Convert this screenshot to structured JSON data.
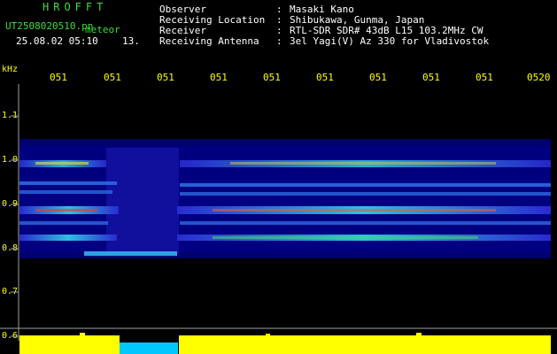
{
  "header": {
    "app_title": "HROFFT",
    "file_name": "UT2508020510.pn",
    "file_tag": "meteor",
    "time_stamp": "25.08.02 05:10",
    "count": "13.",
    "info": [
      {
        "label": "Observer",
        "value": "Masaki Kano"
      },
      {
        "label": "Receiving Location",
        "value": "Shibukawa, Gunma, Japan"
      },
      {
        "label": "Receiver",
        "value": "RTL-SDR SDR# 43dB L15 103.2MHz CW"
      },
      {
        "label": "Receiving Antenna",
        "value": "3el Yagi(V) Az 330 for Vladivostok"
      }
    ]
  },
  "axis": {
    "unit": "kHz",
    "time_ticks": [
      "051",
      "051",
      "051",
      "051",
      "051",
      "051",
      "051",
      "051",
      "051",
      "0520"
    ],
    "freq_ticks": [
      "1.1",
      "1.0",
      "0.9",
      "0.8",
      "0.7",
      "0.6"
    ]
  },
  "colors": {
    "header_green": "#3cdc3c",
    "label_yellow": "#ffff00",
    "spectrogram_bg": "#00007a",
    "signal_power": "#ffff00",
    "gap_color": "#00c8ff"
  }
}
